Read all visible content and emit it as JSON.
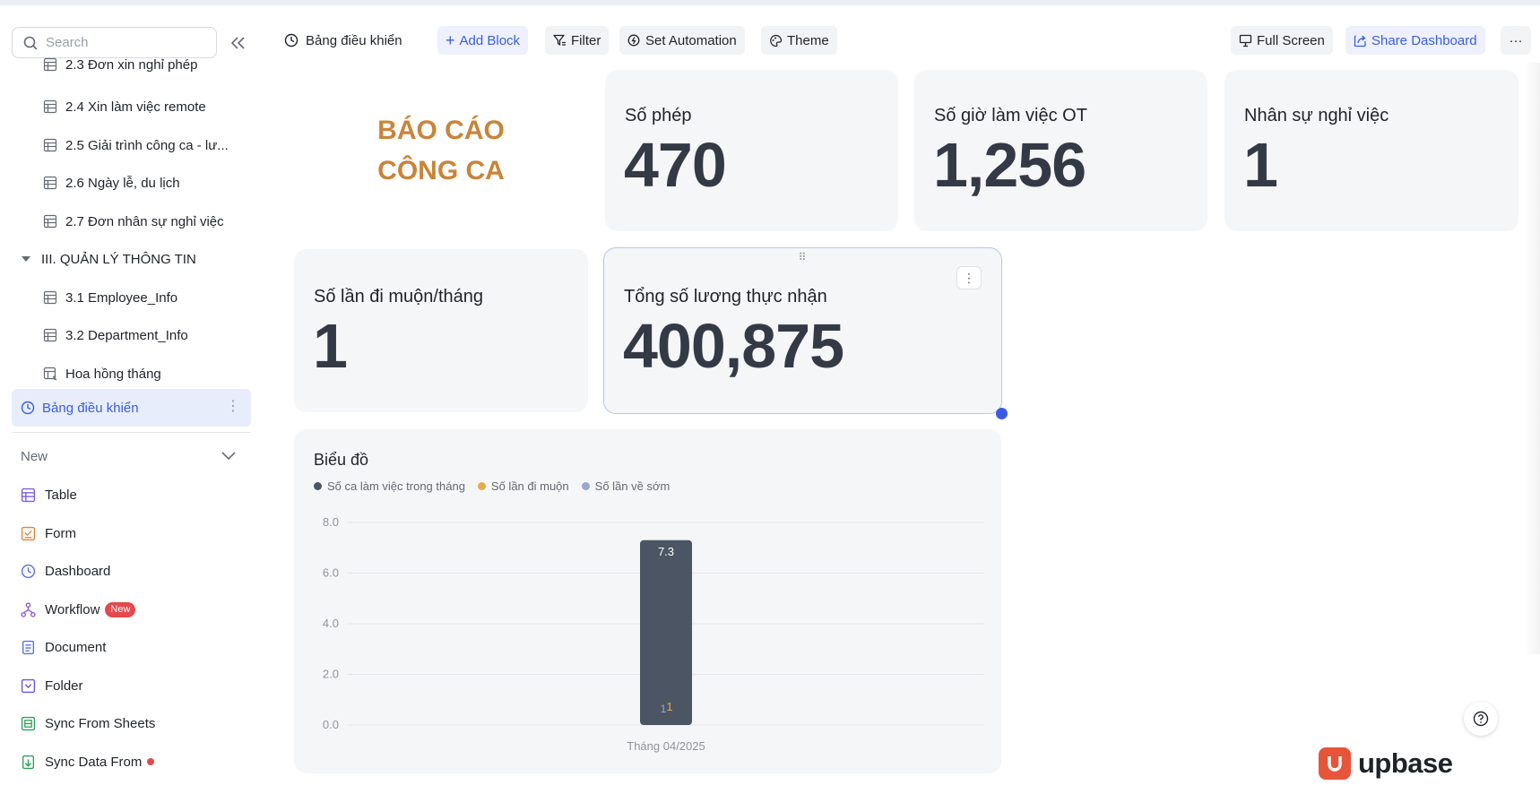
{
  "sidebar": {
    "search_placeholder": "Search",
    "clipped_item": "2.3 Đơn xin nghỉ phép",
    "items": [
      {
        "label": "2.4 Xin làm việc remote"
      },
      {
        "label": "2.5 Giải trình công ca - lư..."
      },
      {
        "label": "2.6 Ngày lễ, du lịch"
      },
      {
        "label": "2.7 Đơn nhân sự nghỉ việc"
      }
    ],
    "group_label": "III. QUẢN LÝ THÔNG TIN",
    "group_items": [
      {
        "label": "3.1 Employee_Info"
      },
      {
        "label": "3.2 Department_Info"
      },
      {
        "label": "Hoa hồng tháng"
      }
    ],
    "active_label": "Bảng điều khiển",
    "new_label": "New",
    "new_items": [
      {
        "label": "Table"
      },
      {
        "label": "Form"
      },
      {
        "label": "Dashboard"
      },
      {
        "label": "Workflow",
        "badge": "New"
      },
      {
        "label": "Document"
      },
      {
        "label": "Folder"
      },
      {
        "label": "Sync From Sheets"
      },
      {
        "label": "Sync Data From"
      }
    ]
  },
  "toolbar": {
    "title": "Bảng điều khiển",
    "add_block": "Add Block",
    "filter": "Filter",
    "set_automation": "Set Automation",
    "theme": "Theme",
    "full_screen": "Full Screen",
    "share_dashboard": "Share Dashboard",
    "more": "···"
  },
  "cards": {
    "report_title_line1": "BÁO CÁO",
    "report_title_line2": "CÔNG CA",
    "leave": {
      "label": "Số phép",
      "value": "470"
    },
    "ot_hours": {
      "label": "Số giờ làm việc OT",
      "value": "1,256"
    },
    "resigned": {
      "label": "Nhân sự nghỉ việc",
      "value": "1"
    },
    "late_count": {
      "label": "Số lần đi muộn/tháng",
      "value": "1"
    },
    "net_salary": {
      "label": "Tổng số lương thực nhận",
      "value": "400,875"
    }
  },
  "chart_data": {
    "type": "bar",
    "title": "Biểu đồ",
    "categories": [
      "Tháng 04/2025"
    ],
    "series": [
      {
        "name": "Số ca làm việc trong tháng",
        "values": [
          7.3
        ],
        "color": "#4b5563"
      },
      {
        "name": "Số lần đi muộn",
        "values": [
          1
        ],
        "color": "#e8a94e"
      },
      {
        "name": "Số lần về sớm",
        "values": [
          1
        ],
        "color": "#9aa6d6"
      }
    ],
    "data_labels": [
      "7.3",
      "1",
      "1"
    ],
    "y_ticks": [
      "8.0",
      "6.0",
      "4.0",
      "2.0",
      "0.0"
    ],
    "ylim": [
      0,
      8
    ],
    "stacked": true,
    "grid": true,
    "legend_position": "top-left"
  },
  "branding": {
    "name": "upbase",
    "accent": "#e6553a"
  },
  "colors": {
    "accent": "#3b5ce0",
    "title_orange": "#c9843a"
  }
}
